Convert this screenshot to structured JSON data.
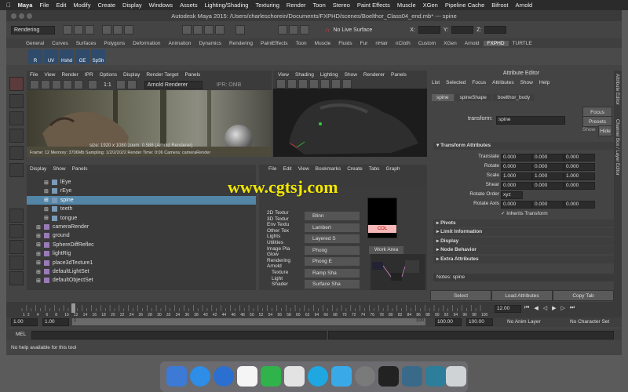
{
  "mac_menu": [
    "Maya",
    "File",
    "Edit",
    "Modify",
    "Create",
    "Display",
    "Windows",
    "Assets",
    "Lighting/Shading",
    "Texturing",
    "Render",
    "Toon",
    "Stereo",
    "Paint Effects",
    "Muscle",
    "XGen",
    "Pipeline Cache",
    "Bifrost",
    "Arnold"
  ],
  "window_title": "Autodesk Maya 2015: /Users/charleschorein/Documents/FXPHD/scenes/Boelthor_Class04_end.mb*  ---  spine",
  "status": {
    "menuset": "Rendering",
    "live_surface": "No Live Surface",
    "sym_x": "X:",
    "sym_y": "Y:",
    "sym_z": "Z:"
  },
  "shelf_tabs": [
    "General",
    "Curves",
    "Surfaces",
    "Polygons",
    "Deformation",
    "Animation",
    "Dynamics",
    "Rendering",
    "PaintEffects",
    "Toon",
    "Muscle",
    "Fluids",
    "Fur",
    "nHair",
    "nCloth",
    "Custom",
    "XGen",
    "Arnold",
    "FXPHD",
    "TURTLE"
  ],
  "shelf_active": "FXPHD",
  "shelf_buttons": [
    "R",
    "UV",
    "Hshd",
    "GE",
    "SpSh"
  ],
  "render_view": {
    "menu": [
      "File",
      "View",
      "Render",
      "IPR",
      "Options",
      "Display",
      "Render Target",
      "Panels"
    ],
    "renderer": "Arnold Renderer",
    "ratio": "1:1",
    "ipr": "IPR: OMB",
    "info": "size: 1920 x 1080  zoom: 0.588     (Arnold Renderer)",
    "info2": "Frame: 12     Memory: 3706Mb    Sampling: 1/2/2/2/2/2     Render Time: 0:06     Camera: cameraRender"
  },
  "viewport": {
    "menu": [
      "View",
      "Shading",
      "Lighting",
      "Show",
      "Renderer",
      "Panels"
    ]
  },
  "outliner": {
    "menu": [
      "Display",
      "Show",
      "Panels"
    ],
    "items": [
      {
        "label": "lEye",
        "depth": 2,
        "selected": false
      },
      {
        "label": "rEye",
        "depth": 2,
        "selected": false
      },
      {
        "label": "spine",
        "depth": 2,
        "selected": true
      },
      {
        "label": "teeth",
        "depth": 2,
        "selected": false
      },
      {
        "label": "tongue",
        "depth": 2,
        "selected": false
      },
      {
        "label": "cameraRender",
        "depth": 1,
        "selected": false
      },
      {
        "label": "ground",
        "depth": 1,
        "selected": false
      },
      {
        "label": "SphereDiffReflec",
        "depth": 1,
        "selected": false
      },
      {
        "label": "lightRig",
        "depth": 1,
        "selected": false
      },
      {
        "label": "place3dTexture1",
        "depth": 1,
        "selected": false
      },
      {
        "label": "defaultLightSet",
        "depth": 1,
        "selected": false
      },
      {
        "label": "defaultObjectSet",
        "depth": 1,
        "selected": false
      }
    ]
  },
  "hypershade": {
    "menu": [
      "File",
      "Edit",
      "View",
      "Bookmarks",
      "Create",
      "Tabs",
      "Graph"
    ],
    "categories": [
      "2D Textur",
      "3D Textur",
      "Env Textu",
      "Other Tex",
      "Lights",
      "Utilities",
      "Image Pla",
      "Glow",
      "Rendering",
      "Arnold",
      "Texture",
      "Light",
      "Shader"
    ],
    "shaders": [
      "Blinn",
      "Lambert",
      "Layered S",
      "Phong",
      "Phong E",
      "Ramp Sha",
      "Surface Sha"
    ],
    "swatch_label": "COL",
    "work_area": "Work Area"
  },
  "watermark": "www.cgtsj.com",
  "attr_editor": {
    "title": "Attribute Editor",
    "menu": [
      "List",
      "Selected",
      "Focus",
      "Attributes",
      "Show",
      "Help"
    ],
    "tabs": [
      "spine",
      "spineShape",
      "boelthor_body"
    ],
    "transform_label": "transform:",
    "transform_value": "spine",
    "focus": "Focus",
    "presets": "Presets",
    "show": "Show",
    "hide": "Hide",
    "section": "Transform Attributes",
    "rows": [
      {
        "label": "Translate",
        "values": [
          "0.000",
          "0.000",
          "0.000"
        ]
      },
      {
        "label": "Rotate",
        "values": [
          "0.000",
          "0.000",
          "0.000"
        ]
      },
      {
        "label": "Scale",
        "values": [
          "1.000",
          "1.000",
          "1.000"
        ]
      },
      {
        "label": "Shear",
        "values": [
          "0.000",
          "0.000",
          "0.000"
        ]
      }
    ],
    "rotate_order_label": "Rotate Order",
    "rotate_order": "xyz",
    "rotate_axis_label": "Rotate Axis",
    "rotate_axis": [
      "0.000",
      "0.000",
      "0.000"
    ],
    "inherits": "Inherits Transform",
    "sections": [
      "Pivots",
      "Limit Information",
      "Display",
      "Node Behavior",
      "Extra Attributes"
    ],
    "notes": "Notes:  spine",
    "buttons": [
      "Select",
      "Load Attributes",
      "Copy Tab"
    ],
    "side_tabs": [
      "Attribute Editor",
      "Channel Box / Layer Editor"
    ]
  },
  "timeslider": {
    "ticks": [
      "1",
      "2",
      "4",
      "6",
      "8",
      "10",
      "12",
      "14",
      "16",
      "18",
      "20",
      "22",
      "24",
      "26",
      "28",
      "30",
      "32",
      "34",
      "36",
      "38",
      "40",
      "42",
      "44",
      "46",
      "48",
      "50",
      "52",
      "54",
      "56",
      "58",
      "60",
      "62",
      "64",
      "66",
      "68",
      "70",
      "72",
      "74",
      "76",
      "78",
      "80",
      "82",
      "84",
      "86",
      "88",
      "90",
      "92",
      "94",
      "96",
      "98",
      "100"
    ],
    "current": "12.00"
  },
  "rangeslider": {
    "start": "1.00",
    "start2": "1.00",
    "inner_start": "1",
    "inner_end": "100",
    "end": "100.00",
    "end2": "100.00",
    "anim_layer": "No Anim Layer",
    "char_set": "No Character Set"
  },
  "cmdline": {
    "label": "MEL"
  },
  "helpline": "No help available for this tool"
}
